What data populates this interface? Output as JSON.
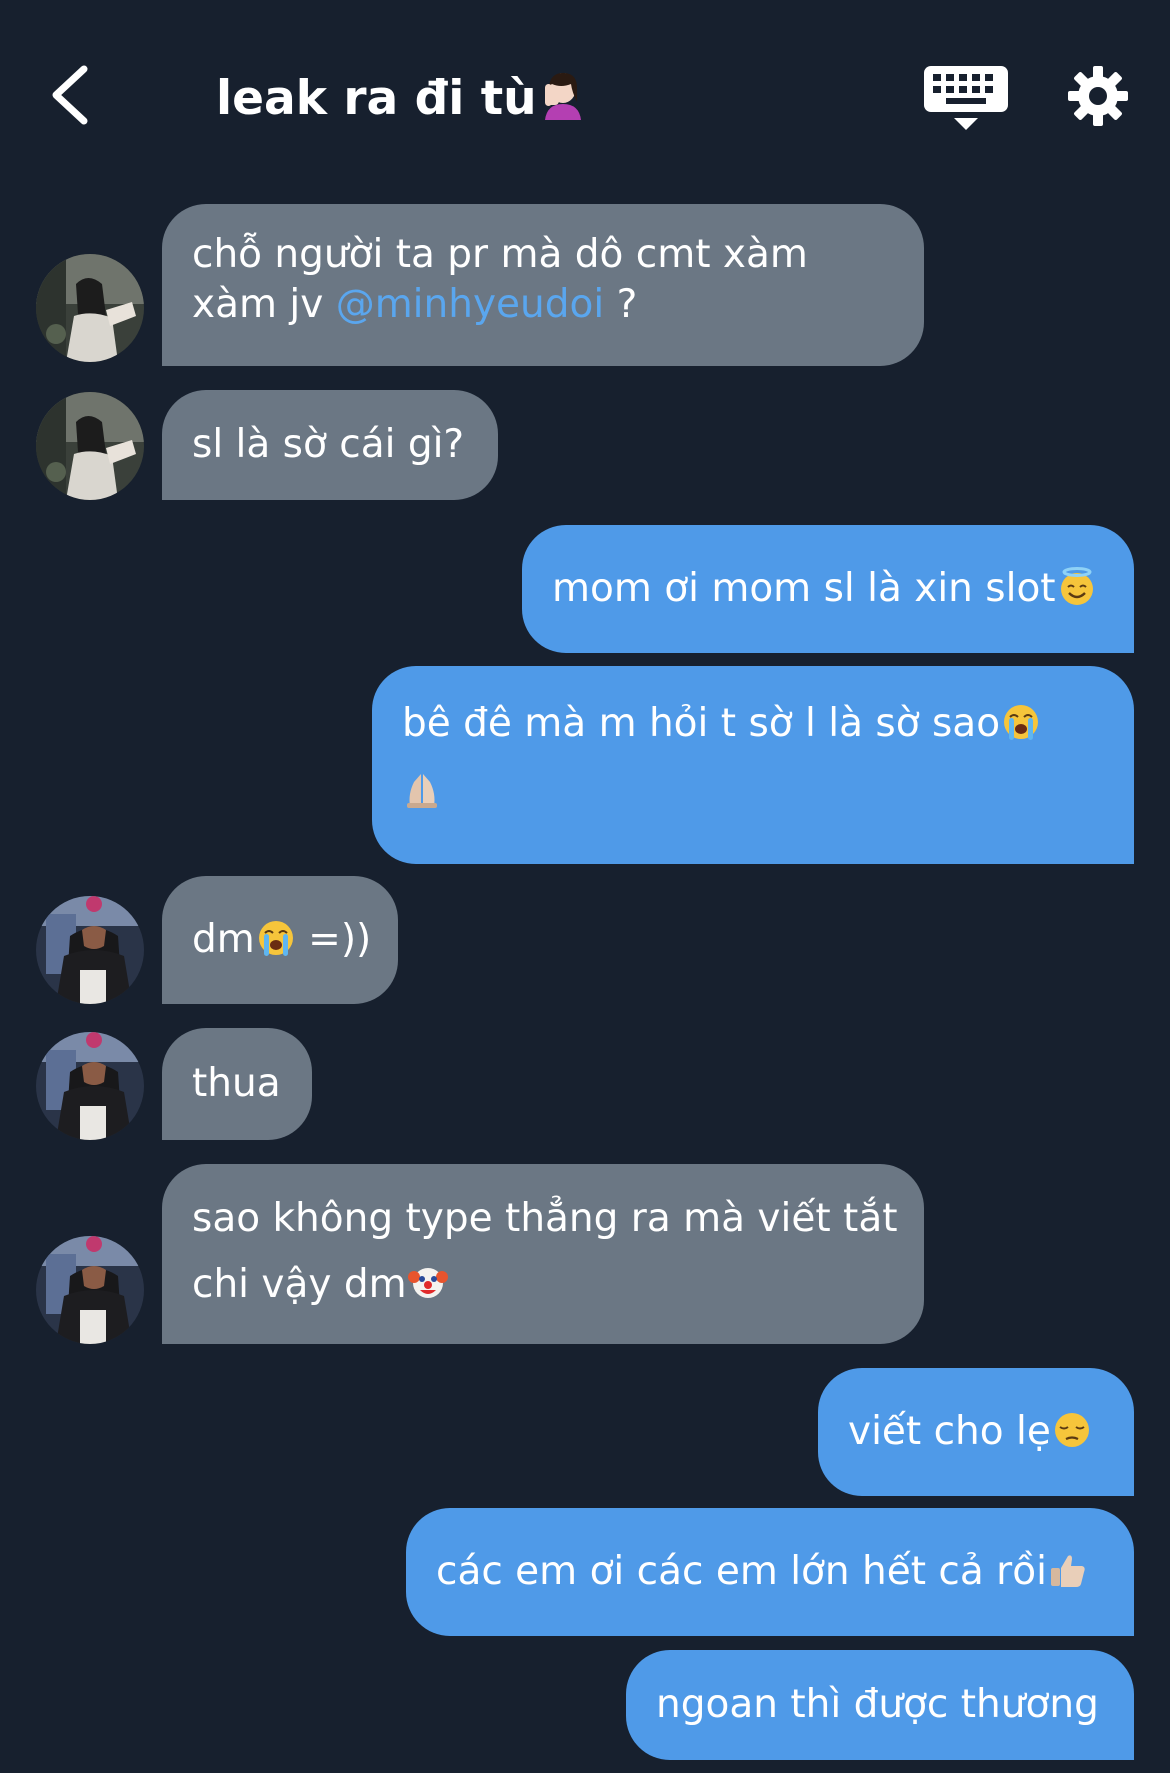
{
  "header": {
    "title": "leak ra đi tù",
    "back_icon": "chevron-left-icon",
    "keyboard_icon": "keyboard-icon",
    "settings_icon": "gear-icon"
  },
  "colors": {
    "background": "#17202e",
    "incoming_bubble": "#6b7784",
    "outgoing_bubble": "#4f9ae8",
    "mention": "#5aa6ee"
  },
  "messages": [
    {
      "direction": "incoming",
      "lines": [
        "chỗ người ta pr mà dô cmt xàm",
        "xàm jv "
      ],
      "mention": "@minhyeudoi",
      "suffix": " ?"
    },
    {
      "direction": "incoming",
      "lines": [
        "sl là sờ cái gì?"
      ]
    },
    {
      "direction": "outgoing",
      "lines": [
        "mom ơi mom sl là xin slot"
      ],
      "emoji": "smiling-face-with-halo-emoji"
    },
    {
      "direction": "outgoing",
      "lines": [
        "bê đê mà m hỏi t sờ l là sờ sao"
      ],
      "emoji": "loudly-crying-face-emoji",
      "emoji2": "folded-hands-emoji"
    },
    {
      "direction": "incoming",
      "lines": [
        "dm",
        " =))"
      ],
      "emoji": "loudly-crying-face-emoji"
    },
    {
      "direction": "incoming",
      "lines": [
        "thua"
      ]
    },
    {
      "direction": "incoming",
      "lines": [
        "sao không type thẳng ra mà viết tắt",
        "chi vậy dm"
      ],
      "emoji": "clown-face-emoji"
    },
    {
      "direction": "outgoing",
      "lines": [
        "viết cho lẹ"
      ],
      "emoji": "pensive-face-emoji"
    },
    {
      "direction": "outgoing",
      "lines": [
        "các em ơi các em lớn hết cả rồi"
      ],
      "emoji": "thumbs-up-emoji"
    },
    {
      "direction": "outgoing",
      "lines": [
        "ngoan thì được thương"
      ]
    }
  ]
}
